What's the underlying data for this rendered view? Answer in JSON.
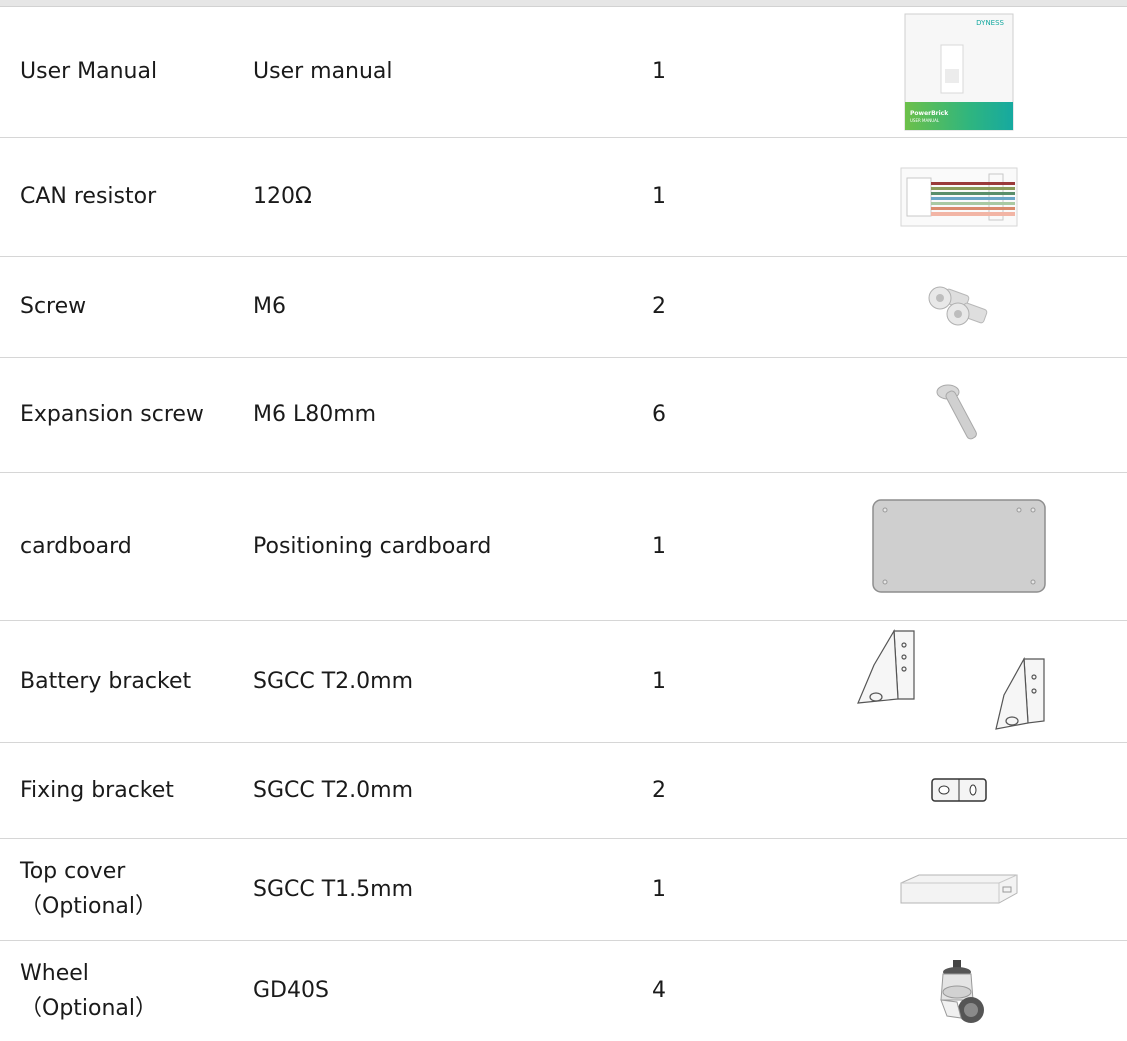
{
  "items": [
    {
      "name": "User Manual",
      "spec": "User manual",
      "qty": "1",
      "icon": "manual-icon",
      "manual_brand": "DYNESS",
      "manual_title": "PowerBrick",
      "manual_sub": "USER MANUAL"
    },
    {
      "name": "CAN resistor",
      "spec": "120Ω",
      "qty": "1",
      "icon": "can-resistor-icon"
    },
    {
      "name": "Screw",
      "spec": "M6",
      "qty": "2",
      "icon": "screw-icon"
    },
    {
      "name": "Expansion screw",
      "spec": "M6 L80mm",
      "qty": "6",
      "icon": "expansion-screw-icon"
    },
    {
      "name": "cardboard",
      "spec": "Positioning cardboard",
      "qty": "1",
      "icon": "cardboard-icon"
    },
    {
      "name": "Battery bracket",
      "spec": "SGCC T2.0mm",
      "qty": "1",
      "icon": "battery-bracket-icon"
    },
    {
      "name": "Fixing bracket",
      "spec": "SGCC T2.0mm",
      "qty": "2",
      "icon": "fixing-bracket-icon"
    },
    {
      "name_line1": "Top cover",
      "name_line2": "（Optional）",
      "spec": "SGCC T1.5mm",
      "qty": "1",
      "icon": "top-cover-icon"
    },
    {
      "name_line1": "Wheel",
      "name_line2": "（Optional）",
      "spec": "GD40S",
      "qty": "4",
      "icon": "wheel-icon"
    }
  ],
  "colors": {
    "rule": "#d6d6d6",
    "text": "#1a1a1a",
    "manual_green": "#3dbb6e",
    "manual_teal": "#16a9a0"
  }
}
